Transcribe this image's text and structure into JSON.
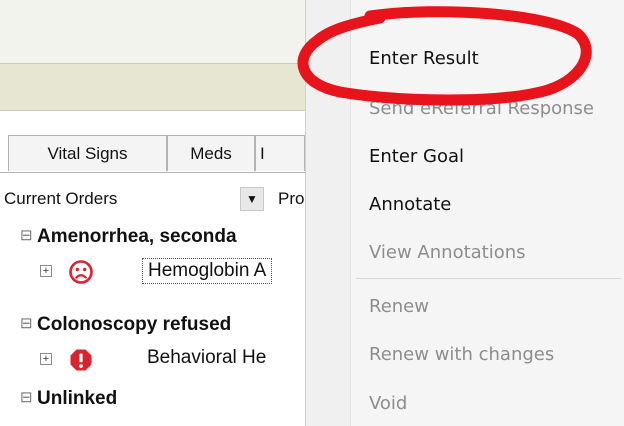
{
  "tabs": [
    {
      "label": "Vital Signs"
    },
    {
      "label": "Meds"
    },
    {
      "label": "I"
    }
  ],
  "filter": {
    "view_label": "Current Orders",
    "next_label": "Pro"
  },
  "tree": {
    "groups": [
      {
        "label": "Amenorrhea, seconda",
        "item": {
          "label": "Hemoglobin A",
          "status_icon": "sad-face-icon"
        }
      },
      {
        "label": "Colonoscopy refused",
        "item": {
          "label": "Behavioral He",
          "status_icon": "alert-icon"
        }
      },
      {
        "label": "Unlinked"
      }
    ]
  },
  "context_menu": {
    "items": [
      {
        "label": "Enter Result",
        "enabled": true
      },
      {
        "label": "Send eReferral Response",
        "enabled": false
      },
      {
        "label": "Enter Goal",
        "enabled": true
      },
      {
        "label": "Annotate",
        "enabled": true
      },
      {
        "label": "View Annotations",
        "enabled": false
      },
      {
        "label": "Renew",
        "enabled": false
      },
      {
        "label": "Renew with changes",
        "enabled": false
      },
      {
        "label": "Void",
        "enabled": false
      }
    ]
  },
  "colors": {
    "annotation_red": "#e8141c",
    "icon_red": "#d9232d",
    "disabled_text": "#8d8d8d"
  }
}
